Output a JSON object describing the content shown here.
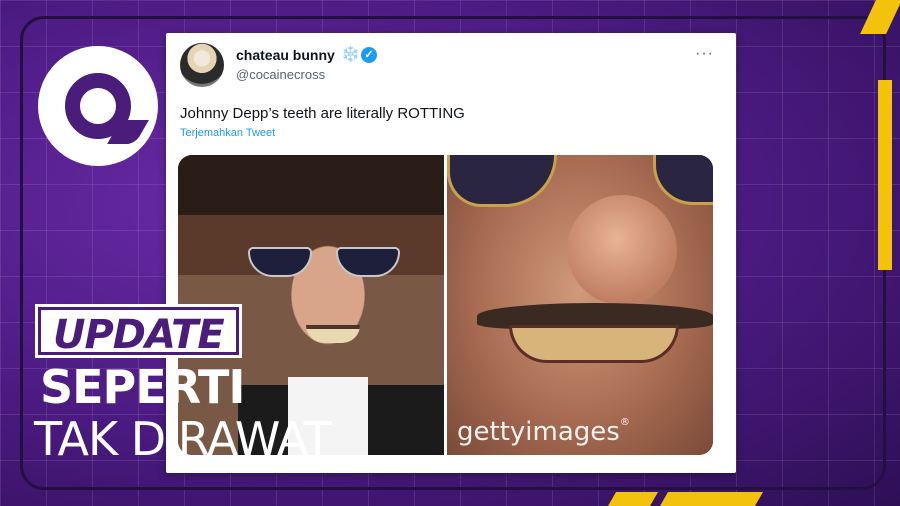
{
  "tweet": {
    "display_name": "chateau bunny",
    "name_emoji": "❄️",
    "handle": "@cocainecross",
    "text": "Johnny Depp’s teeth are literally ROTTING",
    "translate_label": "Terjemahkan Tweet",
    "more_icon": "···",
    "verified_icon": "✓",
    "media_watermark": "gettyimages",
    "media_watermark_mark": "®"
  },
  "overlay": {
    "badge": "UPDATE",
    "headline_line1": "SEPERTI",
    "headline_line2": "TAK DIRAWAT"
  },
  "colors": {
    "brand_purple": "#4a1d7a",
    "accent_yellow": "#f2c20c",
    "twitter_blue": "#1d9bf0"
  }
}
